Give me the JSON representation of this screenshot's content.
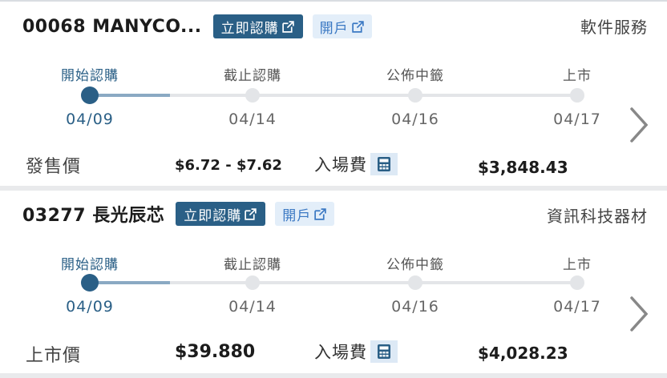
{
  "cards": [
    {
      "code_name": "00068 MANYCO...",
      "subscribe_label": "立即認購",
      "open_account_label": "開戶",
      "industry": "軟件服務",
      "stages": [
        {
          "label": "開始認購",
          "date": "04/09"
        },
        {
          "label": "截止認購",
          "date": "04/14"
        },
        {
          "label": "公佈中籤",
          "date": "04/16"
        },
        {
          "label": "上市",
          "date": "04/17"
        }
      ],
      "current_stage": 0,
      "price_label": "發售價",
      "price_value": "$6.72 - $7.62",
      "fee_label": "入場費",
      "fee_value": "$3,848.43"
    },
    {
      "code_name": "03277 長光辰芯",
      "subscribe_label": "立即認購",
      "open_account_label": "開戶",
      "industry": "資訊科技器材",
      "stages": [
        {
          "label": "開始認購",
          "date": "04/09"
        },
        {
          "label": "截止認購",
          "date": "04/14"
        },
        {
          "label": "公佈中籤",
          "date": "04/16"
        },
        {
          "label": "上市",
          "date": "04/17"
        }
      ],
      "current_stage": 0,
      "price_label": "上市價",
      "price_value": "$39.880",
      "fee_label": "入場費",
      "fee_value": "$4,028.23"
    }
  ],
  "icons": {
    "external_link": "external-link-icon",
    "calculator": "calculator-icon",
    "chevron": "chevron-right-icon"
  },
  "colors": {
    "brand": "#2a5f86",
    "open_account_bg": "#e3eef9",
    "open_account_text": "#3a78c3"
  }
}
